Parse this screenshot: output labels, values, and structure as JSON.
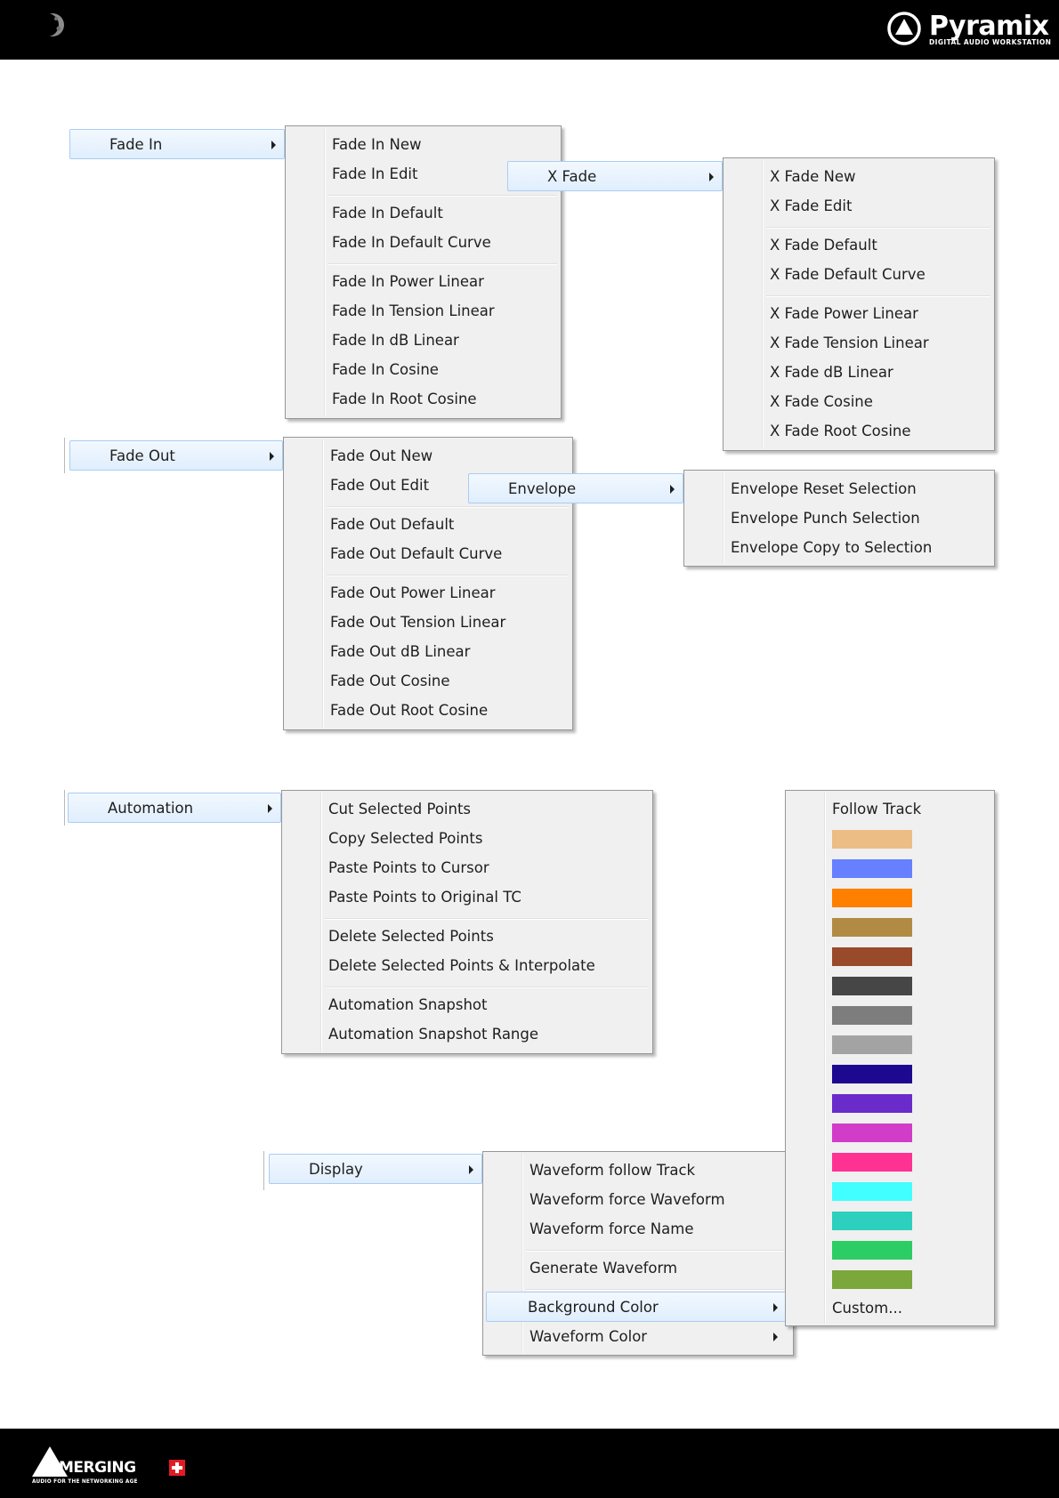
{
  "header": {
    "brand": "Pyramix",
    "tagline": "DIGITAL AUDIO WORKSTATION"
  },
  "footer": {
    "brand": "MERGING",
    "tagline": "AUDIO FOR THE NETWORKING AGE"
  },
  "fade_in": {
    "label": "Fade In",
    "items": [
      "Fade In New",
      "Fade In Edit",
      "Fade In Default",
      "Fade In Default Curve",
      "Fade In Power Linear",
      "Fade In Tension Linear",
      "Fade In dB Linear",
      "Fade In Cosine",
      "Fade In Root Cosine"
    ]
  },
  "x_fade": {
    "label": "X Fade",
    "items": [
      "X Fade New",
      "X Fade Edit",
      "X Fade Default",
      "X Fade Default Curve",
      "X Fade Power Linear",
      "X Fade Tension Linear",
      "X Fade dB Linear",
      "X Fade Cosine",
      "X Fade Root Cosine"
    ]
  },
  "fade_out": {
    "label": "Fade Out",
    "items": [
      "Fade Out New",
      "Fade Out Edit",
      "Fade Out Default",
      "Fade Out Default Curve",
      "Fade Out Power Linear",
      "Fade Out Tension Linear",
      "Fade Out dB Linear",
      "Fade Out Cosine",
      "Fade Out Root Cosine"
    ]
  },
  "envelope": {
    "label": "Envelope",
    "items": [
      "Envelope Reset Selection",
      "Envelope Punch Selection",
      "Envelope Copy to Selection"
    ]
  },
  "automation": {
    "label": "Automation",
    "items": [
      "Cut Selected Points",
      "Copy Selected Points",
      "Paste Points to Cursor",
      "Paste Points to Original TC",
      "Delete Selected Points",
      "Delete Selected Points & Interpolate",
      "Automation Snapshot",
      "Automation Snapshot Range"
    ]
  },
  "display": {
    "label": "Display",
    "items": [
      "Waveform follow Track",
      "Waveform force Waveform",
      "Waveform force Name",
      "Generate Waveform",
      "Background Color",
      "Waveform Color"
    ]
  },
  "color_menu": {
    "follow": "Follow Track",
    "custom": "Custom...",
    "colors": [
      "#ecbd84",
      "#6680ff",
      "#ff8000",
      "#b18b44",
      "#984a2a",
      "#464646",
      "#7d7d7d",
      "#a3a3a3",
      "#1d0890",
      "#6a2bcb",
      "#d13dc8",
      "#ff3293",
      "#41fffe",
      "#2dcfbd",
      "#2ccd64",
      "#7ba73b"
    ]
  }
}
